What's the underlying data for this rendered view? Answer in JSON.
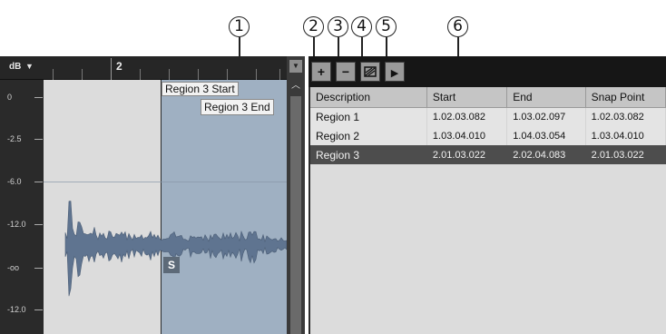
{
  "callouts": [
    "1",
    "2",
    "3",
    "4",
    "5",
    "6"
  ],
  "waveform": {
    "db_label": "dB",
    "db_menu_icon": "dropdown-arrow-icon",
    "bar_number": "2",
    "scale_labels": [
      "0",
      "-2.5",
      "-6.0",
      "-12.0",
      "-oo",
      "-12.0"
    ],
    "region_start_label": "Region 3 Start",
    "region_end_label": "Region 3 End",
    "snap_marker": "S"
  },
  "scrollbar": {
    "menu_icon": "dropdown-arrow-icon",
    "up_icon": "chevron-up-icon"
  },
  "toolbar": {
    "add_icon": "add-region-icon",
    "remove_icon": "remove-region-icon",
    "select_icon": "select-region-icon",
    "play_icon": "play-region-icon",
    "add_glyph": "+",
    "remove_glyph": "−",
    "play_glyph": "▶"
  },
  "region_table": {
    "columns": [
      "Description",
      "Start",
      "End",
      "Snap Point"
    ],
    "rows": [
      {
        "description": "Region 1",
        "start": "1.02.03.082",
        "end": "1.03.02.097",
        "snap": "1.02.03.082",
        "selected": false
      },
      {
        "description": "Region 2",
        "start": "1.03.04.010",
        "end": "1.04.03.054",
        "snap": "1.03.04.010",
        "selected": false
      },
      {
        "description": "Region 3",
        "start": "2.01.03.022",
        "end": "2.02.04.083",
        "snap": "2.01.03.022",
        "selected": true
      }
    ]
  },
  "colors": {
    "selection": "#9fb0c2",
    "waveform": "#5f7490",
    "selected_row": "#4d4d4d"
  }
}
